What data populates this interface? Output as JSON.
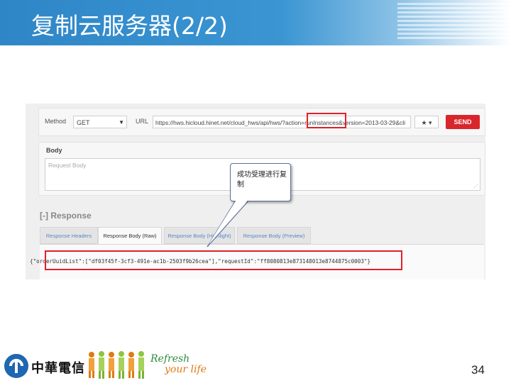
{
  "slide": {
    "title": "复制云服务器(2/2)",
    "page_number": "34"
  },
  "request": {
    "method_label": "Method",
    "method_value": "GET",
    "url_label": "URL",
    "url_value": "https://hws.hicloud.hinet.net/cloud_hws/api/hws/?action=runInstances&version=2013-03-29&cli",
    "star_label": "★ ▾",
    "send_label": "SEND"
  },
  "body": {
    "title": "Body",
    "placeholder": "Request Body"
  },
  "response": {
    "title": "[-] Response",
    "tabs": [
      "Response Headers",
      "Response Body (Raw)",
      "Response Body (Highlight)",
      "Response Body (Preview)"
    ],
    "active_tab": "Response Body (Raw)",
    "raw_text": "{\"orderUuidList\":[\"df03f45f-3cf3-491e-ac1b-2503f9b26cea\"],\"requestId\":\"ff8080813e873148013e8744875c0003\"}"
  },
  "callout": {
    "text": "成功受理进行复制"
  },
  "footer": {
    "company_name": "中華電信",
    "slogan_line1": "Refresh",
    "slogan_line2": "your life"
  },
  "colors": {
    "header_blue": "#2f86c7",
    "send_red": "#d9262b",
    "highlight_red": "#e0202a"
  }
}
